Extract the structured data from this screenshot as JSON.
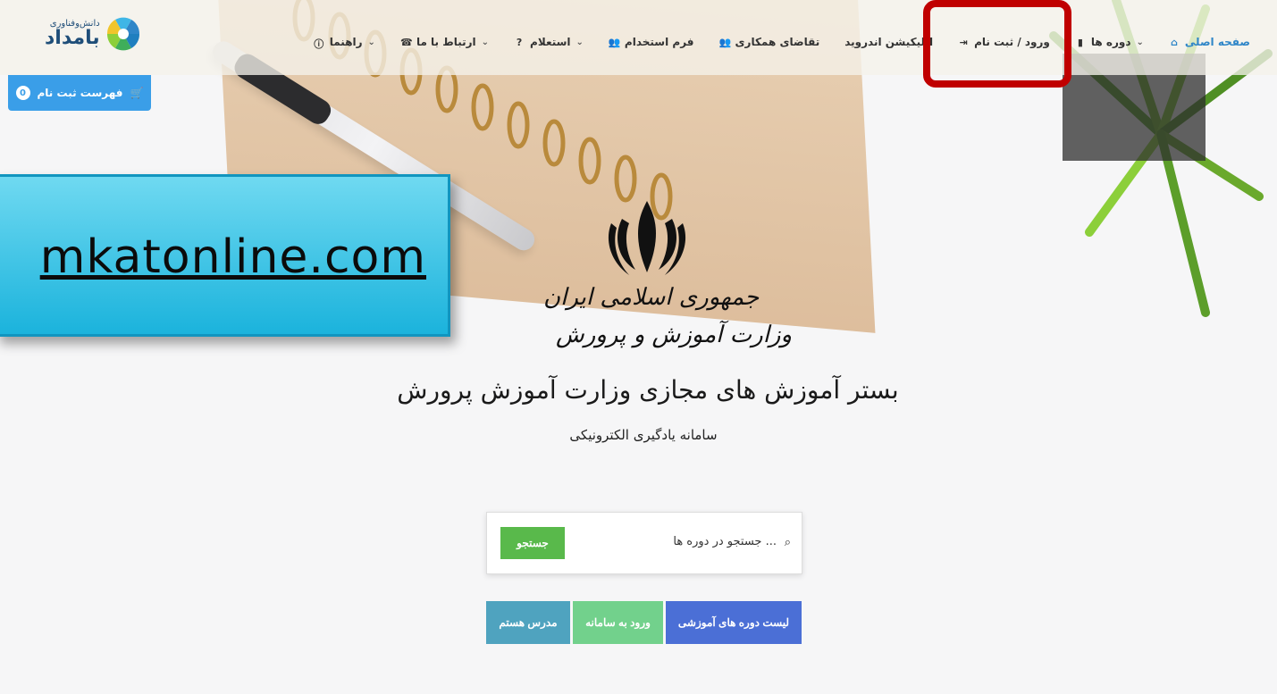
{
  "logo": {
    "small": "دانش‌وفناوری",
    "big": "بامداد"
  },
  "nav": {
    "home": "صفحه اصلی",
    "courses": "دوره ها",
    "login": "ورود / ثبت نام",
    "android": "اپلیکیشن اندروید",
    "cooperation": "تقاضای همکاری",
    "employment": "فرم استخدام",
    "inquiry": "استعلام",
    "contact": "ارتباط با ما",
    "help": "راهنما"
  },
  "cart": {
    "label": "فهرست ثبت نام",
    "count": "0"
  },
  "watermark": {
    "text": "mkatonline.com"
  },
  "emblem": {
    "line1": "جمهوری اسلامی ایران",
    "line2": "وزارت آموزش و پرورش"
  },
  "hero": {
    "title": "بستر آموزش های مجازی وزارت آموزش پرورش",
    "subtitle": "سامانه یادگیری الکترونیکی"
  },
  "search": {
    "placeholder": "جستجو در دوره ها ...",
    "button": "جستجو"
  },
  "buttons": {
    "courses": "لیست دوره های آموزشی",
    "login": "ورود به سامانه",
    "teacher": "مدرس هستم"
  },
  "colors": {
    "accent": "#3a9ee8",
    "highlight": "#c00000",
    "search_button": "#59b94b"
  }
}
